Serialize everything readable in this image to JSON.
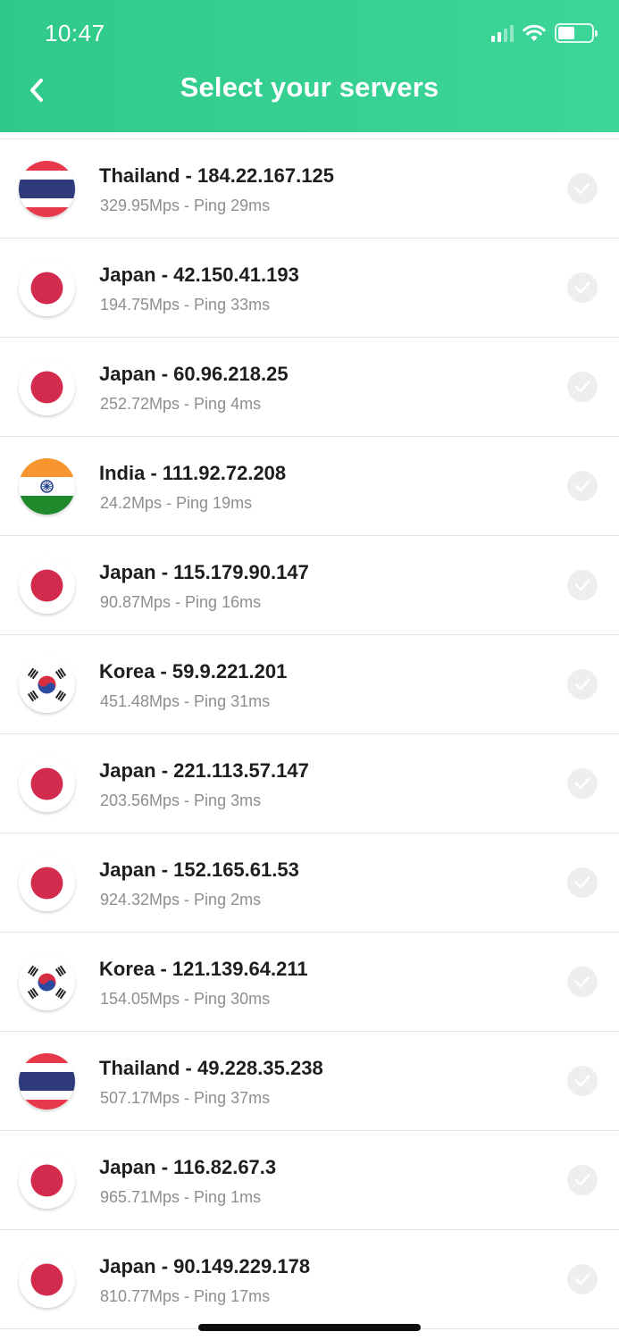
{
  "status_bar": {
    "time": "10:47"
  },
  "header": {
    "title": "Select your servers"
  },
  "colors": {
    "header": "#34cf91",
    "thailand_red": "#e8394a",
    "thailand_blue": "#2f3a7a",
    "japan_red": "#d22b4e",
    "india_saffron": "#f7962e",
    "india_green": "#1f8a2b",
    "korea_red": "#d72d43",
    "korea_blue": "#2b4aa0"
  },
  "servers": [
    {
      "country": "thailand",
      "name": "Thailand - 184.22.167.125",
      "stats": "329.95Mps - Ping 29ms"
    },
    {
      "country": "japan",
      "name": "Japan - 42.150.41.193",
      "stats": "194.75Mps - Ping 33ms"
    },
    {
      "country": "japan",
      "name": "Japan - 60.96.218.25",
      "stats": "252.72Mps - Ping 4ms"
    },
    {
      "country": "india",
      "name": "India - 111.92.72.208",
      "stats": "24.2Mps - Ping 19ms"
    },
    {
      "country": "japan",
      "name": "Japan - 115.179.90.147",
      "stats": "90.87Mps - Ping 16ms"
    },
    {
      "country": "korea",
      "name": "Korea - 59.9.221.201",
      "stats": "451.48Mps - Ping 31ms"
    },
    {
      "country": "japan",
      "name": "Japan - 221.113.57.147",
      "stats": "203.56Mps - Ping 3ms"
    },
    {
      "country": "japan",
      "name": "Japan - 152.165.61.53",
      "stats": "924.32Mps - Ping 2ms"
    },
    {
      "country": "korea",
      "name": "Korea - 121.139.64.211",
      "stats": "154.05Mps - Ping 30ms"
    },
    {
      "country": "thailand",
      "name": "Thailand - 49.228.35.238",
      "stats": "507.17Mps - Ping 37ms"
    },
    {
      "country": "japan",
      "name": "Japan - 116.82.67.3",
      "stats": "965.71Mps - Ping 1ms"
    },
    {
      "country": "japan",
      "name": "Japan - 90.149.229.178",
      "stats": "810.77Mps - Ping 17ms"
    }
  ]
}
